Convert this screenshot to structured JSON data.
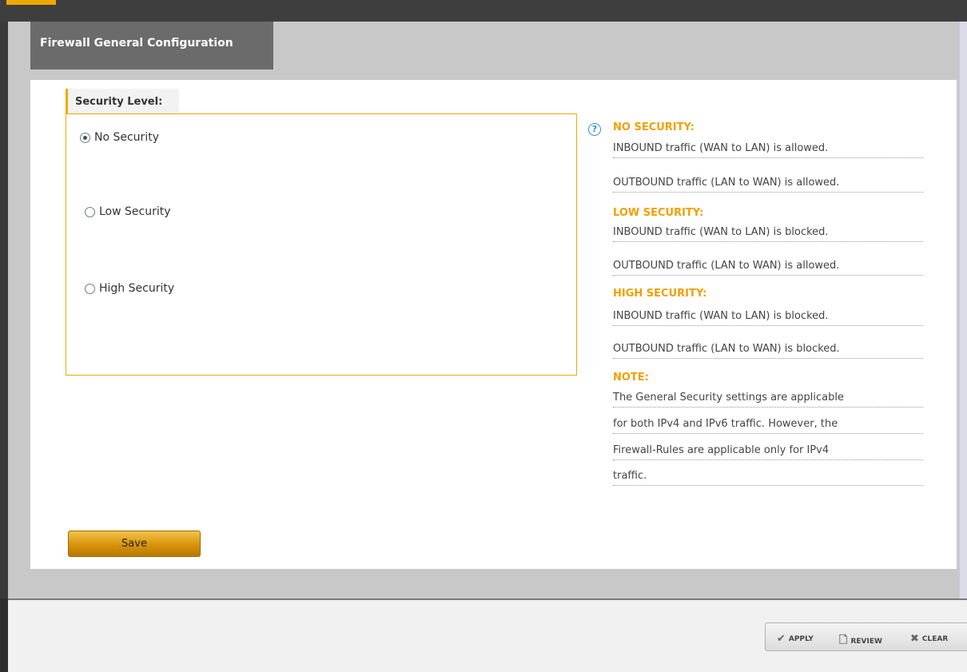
{
  "header": {
    "tab_title": "Firewall General Configuration"
  },
  "security": {
    "legend": "Security Level:",
    "options": [
      {
        "label": "No Security",
        "checked": true
      },
      {
        "label": "Low Security",
        "checked": false
      },
      {
        "label": "High Security",
        "checked": false
      }
    ]
  },
  "help": {
    "icon": "help-icon",
    "sections": [
      {
        "heading": "NO SECURITY:",
        "lines": [
          "INBOUND traffic (WAN to LAN) is allowed.",
          "OUTBOUND traffic (LAN to WAN) is allowed."
        ]
      },
      {
        "heading": "LOW SECURITY:",
        "lines": [
          "INBOUND traffic (WAN to LAN) is blocked.",
          "OUTBOUND traffic (LAN to WAN) is allowed."
        ]
      },
      {
        "heading": "HIGH SECURITY:",
        "lines": [
          "INBOUND traffic (WAN to LAN) is blocked.",
          "OUTBOUND traffic (LAN to WAN) is blocked."
        ]
      },
      {
        "heading": "NOTE:",
        "lines": [
          "The General Security settings are applicable",
          "for both IPv4 and IPv6 traffic. However, the",
          "Firewall-Rules are applicable only for IPv4",
          "traffic."
        ]
      }
    ]
  },
  "form": {
    "save_label": "Save"
  },
  "toolbar": {
    "apply_label": "APPLY",
    "review_label": "REVIEW",
    "clear_label": "CLEAR"
  },
  "colors": {
    "accent": "#f0a800",
    "heading": "#f0a000"
  }
}
